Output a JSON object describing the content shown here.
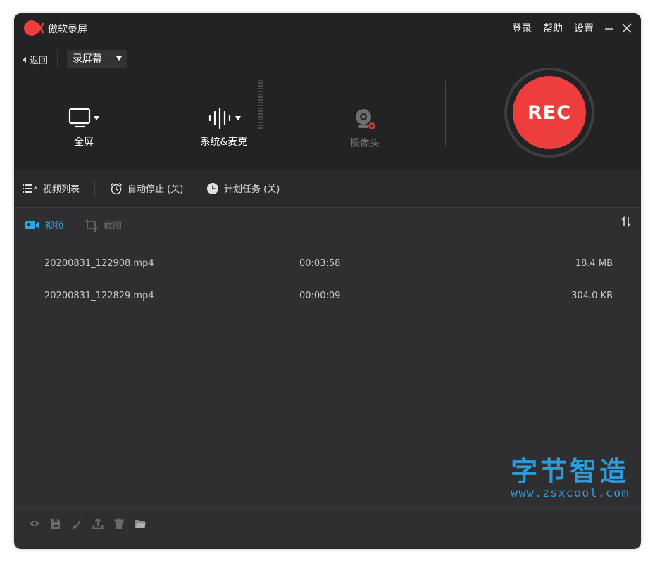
{
  "app": {
    "title": "傲软录屏",
    "menu": {
      "login": "登录",
      "help": "帮助",
      "settings": "设置"
    }
  },
  "panel": {
    "back_label": "返回",
    "mode_label": "录屏幕",
    "screen_label": "全屏",
    "audio_label": "系统&麦克",
    "camera_label": "摄像头",
    "rec_label": "REC"
  },
  "toolbar": {
    "video_list": "视频列表",
    "auto_stop": "自动停止 (关)",
    "schedule": "计划任务 (关)"
  },
  "tabs": {
    "video": "视频",
    "screenshot": "截图"
  },
  "files": [
    {
      "name": "20200831_122908.mp4",
      "duration": "00:03:58",
      "size": "18.4 MB"
    },
    {
      "name": "20200831_122829.mp4",
      "duration": "00:00:09",
      "size": "304.0 KB"
    }
  ],
  "watermark": {
    "title": "字节智造",
    "url": "www.zsxcool.com"
  },
  "colors": {
    "accent": "#2ea6e0",
    "rec": "#ee3d3d",
    "background": "#2f2f31"
  }
}
